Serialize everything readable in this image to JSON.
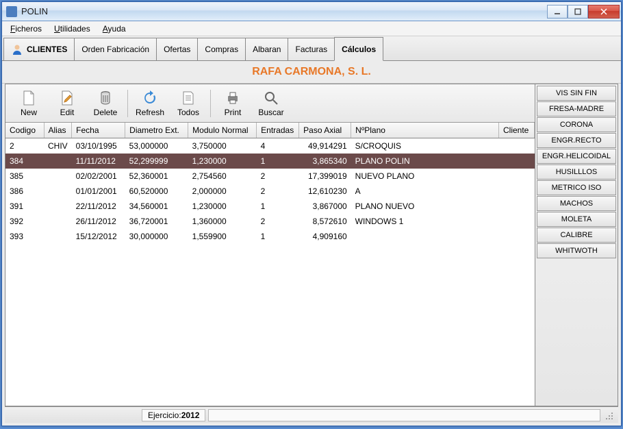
{
  "window": {
    "title": "POLIN"
  },
  "menu": {
    "ficheros": "Ficheros",
    "utilidades": "Utilidades",
    "ayuda": "Ayuda"
  },
  "tabs": {
    "clientes": "CLIENTES",
    "orden": "Orden Fabricación",
    "ofertas": "Ofertas",
    "compras": "Compras",
    "albaran": "Albaran",
    "facturas": "Facturas",
    "calculos": "Cálculos"
  },
  "company_name": "RAFA CARMONA, S. L.",
  "toolbar": {
    "new": "New",
    "edit": "Edit",
    "delete": "Delete",
    "refresh": "Refresh",
    "todos": "Todos",
    "print": "Print",
    "buscar": "Buscar"
  },
  "columns": {
    "codigo": "Codigo",
    "alias": "Alias",
    "fecha": "Fecha",
    "diametro": "Diametro Ext.",
    "modulo": "Modulo Normal",
    "entradas": "Entradas",
    "paso": "Paso Axial",
    "nplano": "NºPlano",
    "cliente": "Cliente"
  },
  "rows": [
    {
      "codigo": "2",
      "alias": "CHIV",
      "fecha": "03/10/1995",
      "diametro": "53,000000",
      "modulo": "3,750000",
      "entradas": "4",
      "paso": "49,914291",
      "nplano": "S/CROQUIS",
      "cliente": "",
      "sel": false
    },
    {
      "codigo": "384",
      "alias": "",
      "fecha": "11/11/2012",
      "diametro": "52,299999",
      "modulo": "1,230000",
      "entradas": "1",
      "paso": "3,865340",
      "nplano": "PLANO POLIN",
      "cliente": "",
      "sel": true
    },
    {
      "codigo": "385",
      "alias": "",
      "fecha": "02/02/2001",
      "diametro": "52,360001",
      "modulo": "2,754560",
      "entradas": "2",
      "paso": "17,399019",
      "nplano": "NUEVO PLANO",
      "cliente": "",
      "sel": false
    },
    {
      "codigo": "386",
      "alias": "",
      "fecha": "01/01/2001",
      "diametro": "60,520000",
      "modulo": "2,000000",
      "entradas": "2",
      "paso": "12,610230",
      "nplano": "A",
      "cliente": "",
      "sel": false
    },
    {
      "codigo": "391",
      "alias": "",
      "fecha": "22/11/2012",
      "diametro": "34,560001",
      "modulo": "1,230000",
      "entradas": "1",
      "paso": "3,867000",
      "nplano": "PLANO NUEVO",
      "cliente": "",
      "sel": false
    },
    {
      "codigo": "392",
      "alias": "",
      "fecha": "26/11/2012",
      "diametro": "36,720001",
      "modulo": "1,360000",
      "entradas": "2",
      "paso": "8,572610",
      "nplano": "WINDOWS 1",
      "cliente": "",
      "sel": false
    },
    {
      "codigo": "393",
      "alias": "",
      "fecha": "15/12/2012",
      "diametro": "30,000000",
      "modulo": "1,559900",
      "entradas": "1",
      "paso": "4,909160",
      "nplano": "",
      "cliente": "",
      "sel": false
    }
  ],
  "sidebar": {
    "items": [
      "VIS SIN FIN",
      "FRESA-MADRE",
      "CORONA",
      "ENGR.RECTO",
      "ENGR.HELICOIDAL",
      "HUSILLLOS",
      "METRICO ISO",
      "MACHOS",
      "MOLETA",
      "CALIBRE",
      "WHITWOTH"
    ]
  },
  "status": {
    "label": "Ejercicio:",
    "year": "2012"
  }
}
